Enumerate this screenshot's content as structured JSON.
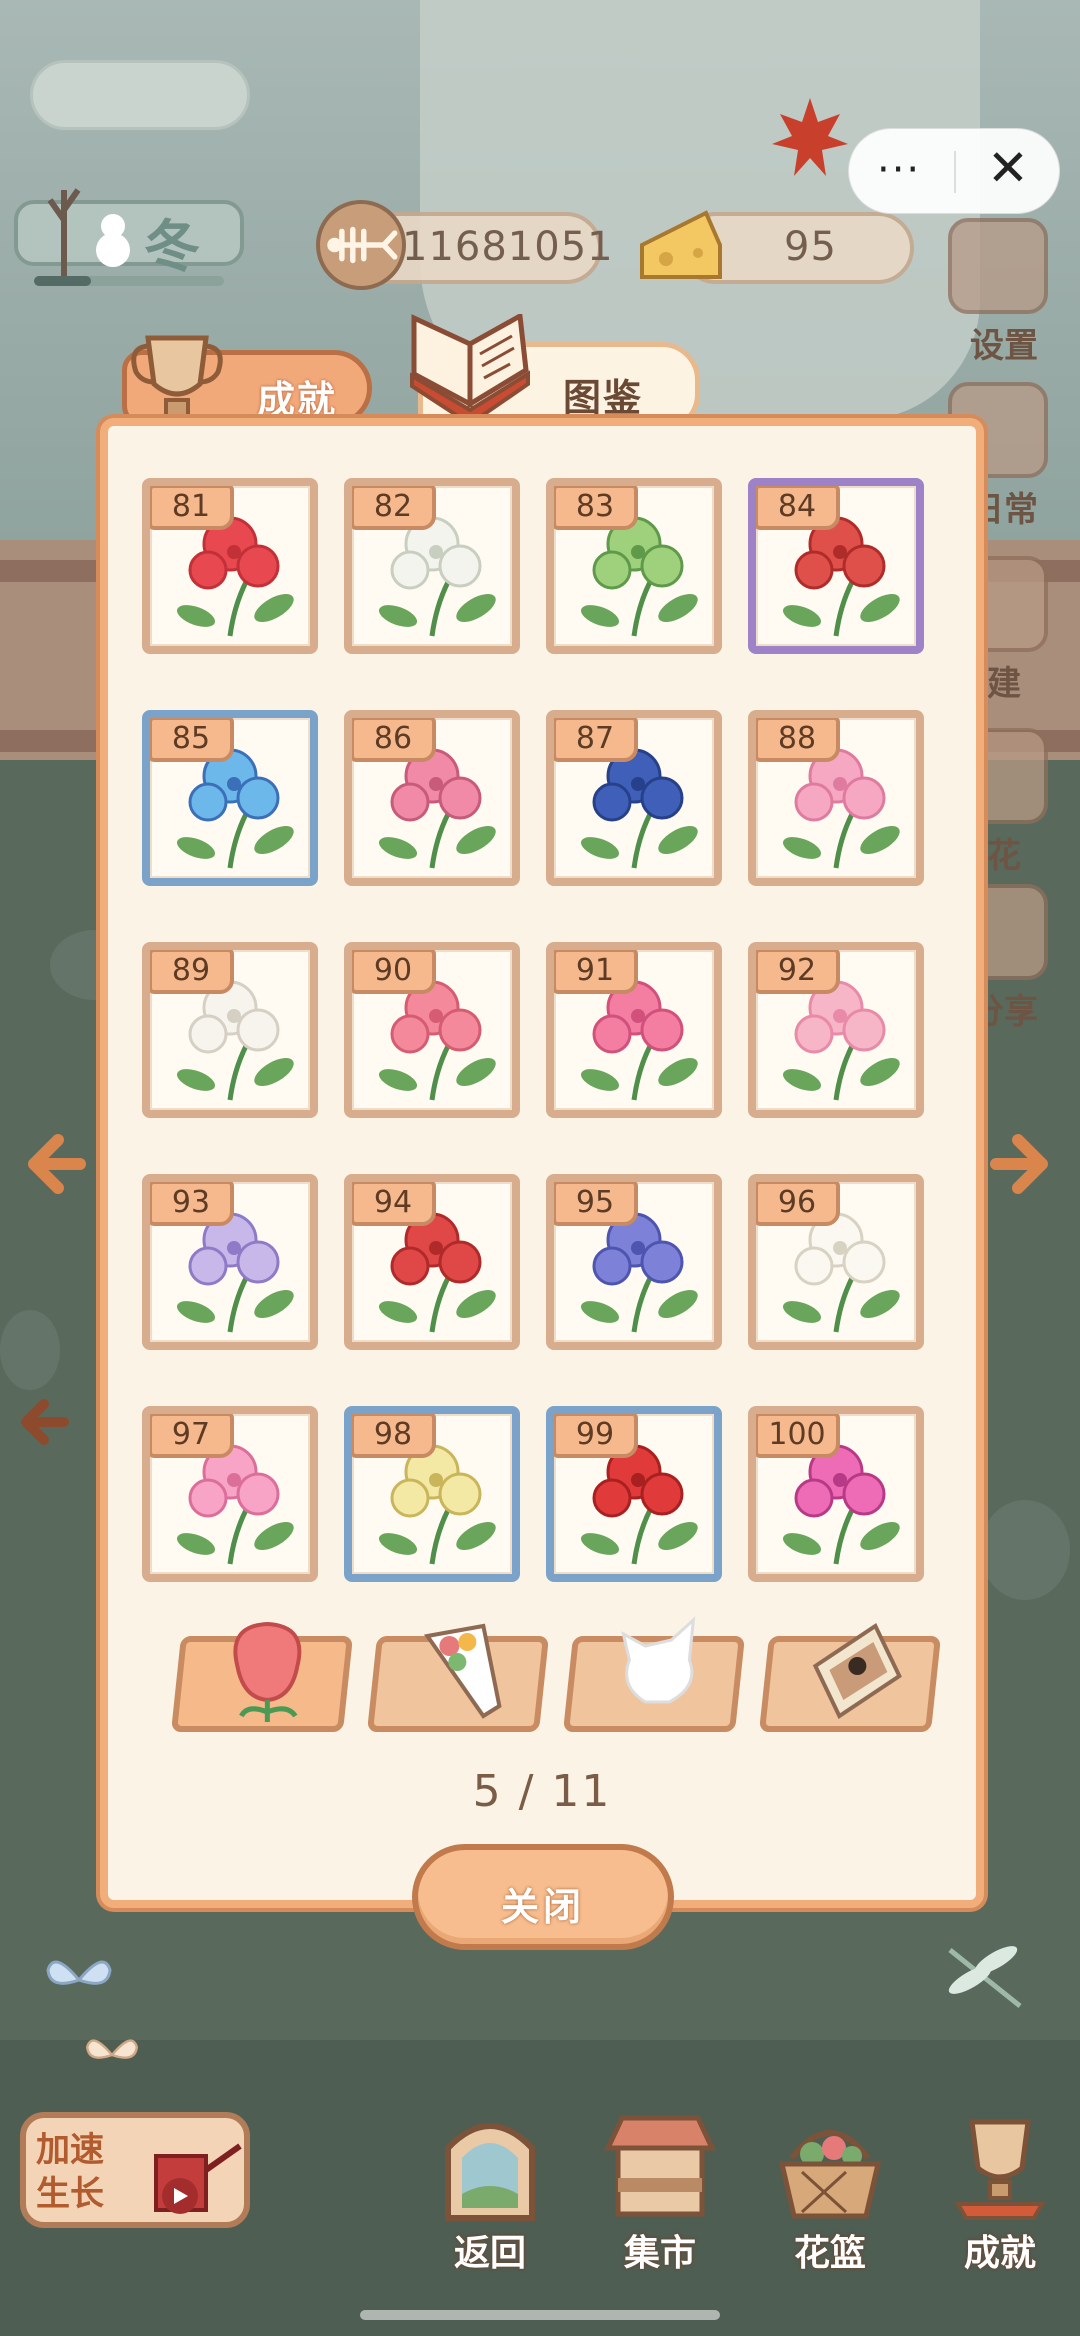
{
  "hud": {
    "season": "冬",
    "season_progress": 0.3,
    "fish_currency": "11681051",
    "cheese_currency": "95",
    "capsule_menu": "···",
    "capsule_close": "✕"
  },
  "side_menu": [
    {
      "label": "设置",
      "icon": "gear-icon"
    },
    {
      "label": "日常",
      "icon": "scroll-icon"
    },
    {
      "label": "建",
      "icon": "build-icon"
    },
    {
      "label": "花",
      "icon": "flower-icon"
    },
    {
      "label": "分享",
      "icon": "share-icon"
    }
  ],
  "tabs": {
    "achievement": "成就",
    "catalog": "图鉴"
  },
  "cards": [
    {
      "num": "81",
      "frame": "normal",
      "flower": "red-bougainvillea"
    },
    {
      "num": "82",
      "frame": "normal",
      "flower": "white-lily"
    },
    {
      "num": "83",
      "frame": "normal",
      "flower": "green-star-flower"
    },
    {
      "num": "84",
      "frame": "purple",
      "flower": "red-cluster"
    },
    {
      "num": "85",
      "frame": "blue",
      "flower": "blue-morning-glory"
    },
    {
      "num": "86",
      "frame": "normal",
      "flower": "pink-blossom-branch"
    },
    {
      "num": "87",
      "frame": "normal",
      "flower": "blue-pea-flower"
    },
    {
      "num": "88",
      "frame": "normal",
      "flower": "pink-peony"
    },
    {
      "num": "89",
      "frame": "normal",
      "flower": "white-rose"
    },
    {
      "num": "90",
      "frame": "normal",
      "flower": "pink-camellia"
    },
    {
      "num": "91",
      "frame": "normal",
      "flower": "pink-fan-flower"
    },
    {
      "num": "92",
      "frame": "normal",
      "flower": "pink-hydrangea"
    },
    {
      "num": "93",
      "frame": "normal",
      "flower": "lilac-trumpet"
    },
    {
      "num": "94",
      "frame": "normal",
      "flower": "red-carnation"
    },
    {
      "num": "95",
      "frame": "normal",
      "flower": "blue-bellflower"
    },
    {
      "num": "96",
      "frame": "normal",
      "flower": "white-jasmine"
    },
    {
      "num": "97",
      "frame": "normal",
      "flower": "pink-vinca"
    },
    {
      "num": "98",
      "frame": "blue",
      "flower": "osmanthus"
    },
    {
      "num": "99",
      "frame": "blue",
      "flower": "red-camellia"
    },
    {
      "num": "100",
      "frame": "normal",
      "flower": "magenta-petunia"
    }
  ],
  "categories": [
    {
      "name": "single-flower",
      "icon": "rose-icon",
      "active": true
    },
    {
      "name": "bouquet",
      "icon": "bouquet-icon",
      "active": false
    },
    {
      "name": "wrap",
      "icon": "paper-icon",
      "active": false
    },
    {
      "name": "card",
      "icon": "postcard-icon",
      "active": false
    }
  ],
  "pagination": {
    "current": 5,
    "total": 11,
    "text": "5 / 11"
  },
  "close_label": "关闭",
  "speed": {
    "label": "加速生长"
  },
  "bottom_nav": [
    {
      "label": "返回",
      "icon": "window-icon"
    },
    {
      "label": "集市",
      "icon": "market-stall-icon"
    },
    {
      "label": "花篮",
      "icon": "basket-icon"
    },
    {
      "label": "成就",
      "icon": "trophy-icon"
    }
  ],
  "colors": {
    "panel_bg": "#fbf4e6",
    "panel_border": "#f1ae7a",
    "card_border": "#d8ad8e",
    "rare_purple": "#9d82c7",
    "rare_blue": "#7ba3c9",
    "accent_orange": "#d9854c"
  }
}
